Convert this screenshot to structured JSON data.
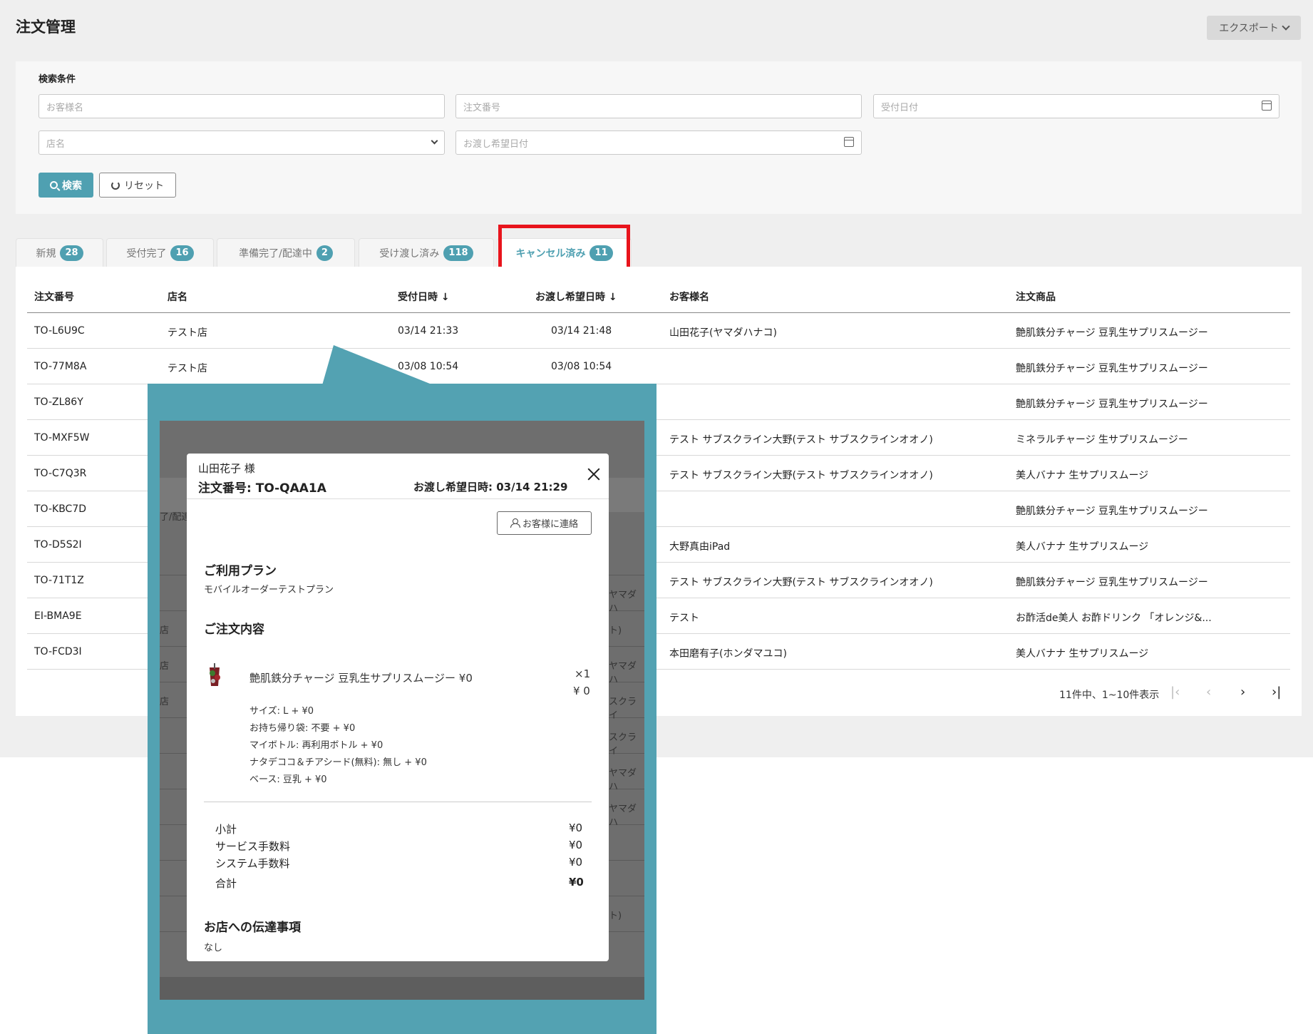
{
  "header": {
    "title": "注文管理",
    "export_label": "エクスポート"
  },
  "search": {
    "section_label": "検索条件",
    "customer_placeholder": "お客様名",
    "order_no_placeholder": "注文番号",
    "received_date_placeholder": "受付日付",
    "store_placeholder": "店名",
    "pickup_date_placeholder": "お渡し希望日付",
    "search_label": "検索",
    "reset_label": "リセット"
  },
  "tabs": [
    {
      "label": "新規",
      "count": "28"
    },
    {
      "label": "受付完了",
      "count": "16"
    },
    {
      "label": "準備完了/配達中",
      "count": "2"
    },
    {
      "label": "受け渡し済み",
      "count": "118"
    },
    {
      "label": "キャンセル済み",
      "count": "11"
    }
  ],
  "table": {
    "headers": [
      "注文番号",
      "店名",
      "受付日時 ↓",
      "お渡し希望日時 ↓",
      "お客様名",
      "注文商品"
    ],
    "rows": [
      [
        "TO-L6U9C",
        "テスト店",
        "03/14 21:33",
        "03/14 21:48",
        "山田花子(ヤマダハナコ)",
        "艶肌鉄分チャージ 豆乳生サプリスムージー"
      ],
      [
        "TO-77M8A",
        "テスト店",
        "03/08 10:54",
        "03/08 10:54",
        "",
        "艶肌鉄分チャージ 豆乳生サプリスムージー"
      ],
      [
        "TO-ZL86Y",
        "",
        "",
        "",
        "",
        "艶肌鉄分チャージ 豆乳生サプリスムージー"
      ],
      [
        "TO-MXF5W",
        "",
        "",
        "",
        "テスト サブスクライン大野(テスト サブスクラインオオノ)",
        "ミネラルチャージ 生サプリスムージー"
      ],
      [
        "TO-C7Q3R",
        "",
        "",
        "",
        "テスト サブスクライン大野(テスト サブスクラインオオノ)",
        "美人バナナ 生サプリスムージ"
      ],
      [
        "TO-KBC7D",
        "",
        "",
        "",
        "",
        "艶肌鉄分チャージ 豆乳生サプリスムージー"
      ],
      [
        "TO-D5S2I",
        "",
        "",
        "",
        "大野真由iPad",
        "美人バナナ 生サプリスムージ"
      ],
      [
        "TO-71T1Z",
        "",
        "",
        "",
        "テスト サブスクライン大野(テスト サブスクラインオオノ)",
        "艶肌鉄分チャージ 豆乳生サプリスムージー"
      ],
      [
        "EI-BMA9E",
        "",
        "",
        "",
        "テスト",
        "お酢活de美人 お酢ドリンク 「オレンジ&..."
      ],
      [
        "TO-FCD3I",
        "",
        "",
        "",
        "本田磨有子(ホンダマユコ)",
        "美人バナナ 生サプリスムージ"
      ]
    ],
    "pager_text": "11件中、1~10件表示",
    "pager_first": "|‹",
    "pager_prev": "‹",
    "pager_next": "›",
    "pager_last": "›|"
  },
  "background_fragments": [
    "了/配達",
    "ヤマダハ",
    "ト)",
    "店",
    "ヤマダハ",
    "店",
    "スクライ",
    "店",
    "スクライ",
    "ヤマダハ",
    "ヤマダハ",
    "ト)"
  ],
  "modal": {
    "customer": "山田花子 様",
    "order_number": "注文番号: TO-QAA1A",
    "pickup": "お渡し希望日時: 03/14 21:29",
    "contact_label": "お客様に連絡",
    "plan_heading": "ご利用プラン",
    "plan_name": "モバイルオーダーテストプラン",
    "order_heading": "ご注文内容",
    "item_name": "艶肌鉄分チャージ 豆乳生サプリスムージー ¥0",
    "item_qty": "×1",
    "item_price": "¥ 0",
    "options": [
      "サイズ: L + ¥0",
      "お持ち帰り袋: 不要 + ¥0",
      "マイボトル: 再利用ボトル + ¥0",
      "ナタデココ＆チアシード(無料): 無し + ¥0",
      "ベース: 豆乳 + ¥0"
    ],
    "subtotal_label": "小計",
    "subtotal": "¥0",
    "service_fee_label": "サービス手数料",
    "service_fee": "¥0",
    "system_fee_label": "システム手数料",
    "system_fee": "¥0",
    "total_label": "合計",
    "total": "¥0",
    "notes_heading": "お店への伝達事項",
    "notes": "なし"
  },
  "colors": {
    "accent": "#4fa0b1",
    "highlight": "#e8141c",
    "callout": "#53a2b2"
  }
}
